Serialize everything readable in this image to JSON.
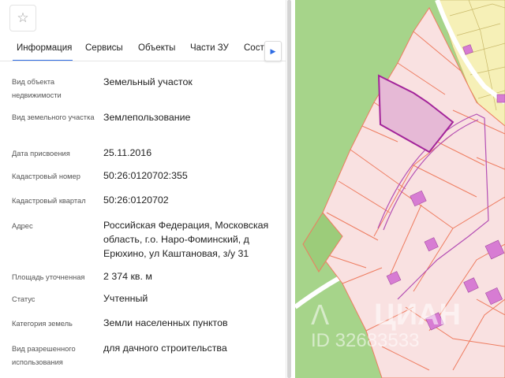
{
  "toolbar": {
    "favorite_icon": "star-outline-icon"
  },
  "tabs": [
    {
      "label": "Информация",
      "active": true
    },
    {
      "label": "Сервисы",
      "active": false
    },
    {
      "label": "Объекты",
      "active": false
    },
    {
      "label": "Части ЗУ",
      "active": false
    },
    {
      "label": "Соста",
      "active": false
    }
  ],
  "tabs_scroll_icon": "arrow-right-icon",
  "info": {
    "object_type": {
      "label": "Вид объекта недвижимости",
      "value": "Земельный участок"
    },
    "land_type": {
      "label": "Вид земельного участка",
      "value": "Землепользование"
    },
    "assignment_date": {
      "label": "Дата присвоения",
      "value": "25.11.2016"
    },
    "cadastral_number": {
      "label": "Кадастровый номер",
      "value": "50:26:0120702:355"
    },
    "cadastral_block": {
      "label": "Кадастровый квартал",
      "value": "50:26:0120702"
    },
    "address": {
      "label": "Адрес",
      "value": "Российская Федерация, Московская область, г.о. Наро-Фоминский, д Ерюхино, ул Каштановая, з/у 31"
    },
    "area": {
      "label": "Площадь уточненная",
      "value": "2 374 кв. м"
    },
    "status": {
      "label": "Статус",
      "value": "Учтенный"
    },
    "land_category": {
      "label": "Категория земель",
      "value": "Земли населенных пунктов"
    },
    "permitted_use": {
      "label": "Вид разрешенного использования",
      "value": "для дачного строительства"
    }
  },
  "map": {
    "watermark": "ЦИАН",
    "watermark_id": "ID 32683533",
    "colors": {
      "forest": "#a6d48a",
      "parcel_fill": "#f9e1e1",
      "parcel_border": "#ee7c60",
      "selected_parcel_fill": "#e6b9d6",
      "selected_parcel_border": "#a3249a",
      "building": "#d77cd3",
      "yellow_zone": "#f6f0b7",
      "road": "#ffffff"
    }
  }
}
